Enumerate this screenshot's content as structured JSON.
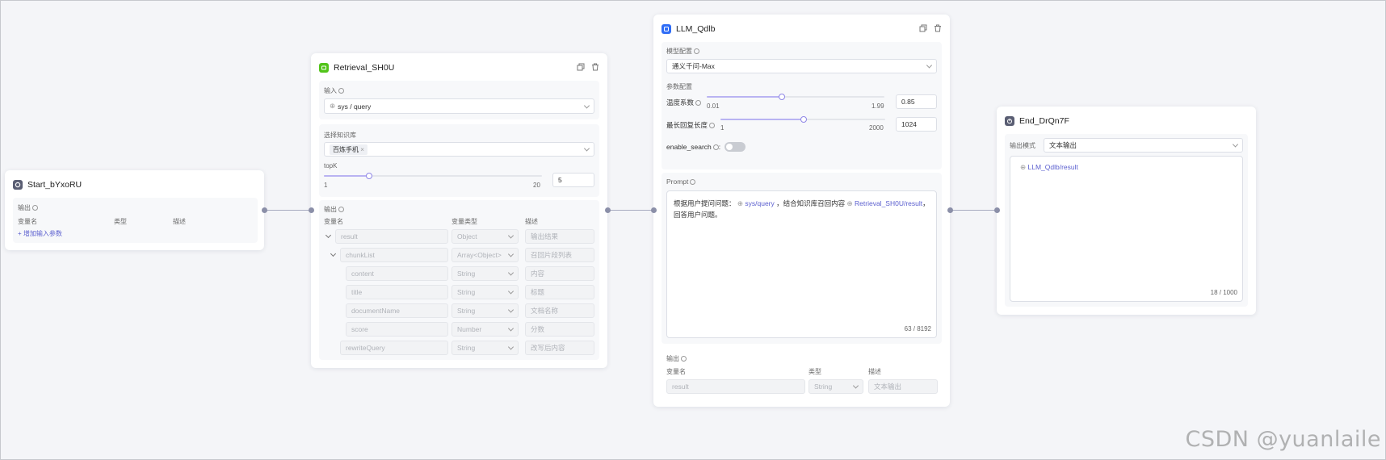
{
  "start": {
    "title": "Start_bYxoRU",
    "output_label": "输出",
    "columns": [
      "变量名",
      "类型",
      "描述"
    ],
    "add_param": "+ 增加输入参数"
  },
  "retrieval": {
    "title": "Retrieval_SH0U",
    "input_label": "输入",
    "input_value": "sys / query",
    "kb_label": "选择知识库",
    "kb_tag": "百炼手机",
    "topk_label": "topK",
    "topk_min": "1",
    "topk_max": "20",
    "topk_value": "5",
    "output_label": "输出",
    "columns": [
      "变量名",
      "变量类型",
      "描述"
    ],
    "rows": [
      {
        "name": "result",
        "type": "Object",
        "desc": "输出结果"
      },
      {
        "name": "chunkList",
        "type": "Array<Object>",
        "desc": "召回片段列表"
      },
      {
        "name": "content",
        "type": "String",
        "desc": "内容"
      },
      {
        "name": "title",
        "type": "String",
        "desc": "标题"
      },
      {
        "name": "documentName",
        "type": "String",
        "desc": "文档名称"
      },
      {
        "name": "score",
        "type": "Number",
        "desc": "分数"
      },
      {
        "name": "rewriteQuery",
        "type": "String",
        "desc": "改写后内容"
      }
    ]
  },
  "llm": {
    "title": "LLM_Qdlb",
    "model_label": "模型配置",
    "model_value": "通义千问-Max",
    "params_label": "参数配置",
    "temp_label": "温度系数",
    "temp_min": "0.01",
    "temp_max": "1.99",
    "temp_value": "0.85",
    "len_label": "最长回复长度",
    "len_min": "1",
    "len_max": "2000",
    "len_value": "1024",
    "search_label": "enable_search",
    "prompt_label": "Prompt",
    "prompt_part1": "根据用户提问问题：",
    "prompt_var1": "sys/query",
    "prompt_part2": "，结合知识库召回内容",
    "prompt_var2": "Retrieval_SH0U/result",
    "prompt_part3": "，",
    "prompt_line2": "回答用户问题。",
    "prompt_count": "63 / 8192",
    "output_label": "输出",
    "columns": [
      "变量名",
      "类型",
      "描述"
    ],
    "out_name": "result",
    "out_type": "String",
    "out_desc": "文本输出"
  },
  "end": {
    "title": "End_DrQn7F",
    "mode_label": "输出模式",
    "mode_value": "文本输出",
    "var_chip": "LLM_Qdlb/result",
    "count": "18 / 1000"
  },
  "watermark": "CSDN @yuanlaile",
  "colors": {
    "accent": "#5b5fcf",
    "retrieval_icon": "#52c41a",
    "llm_icon": "#2f6df6",
    "start_icon": "#5a5e73"
  }
}
